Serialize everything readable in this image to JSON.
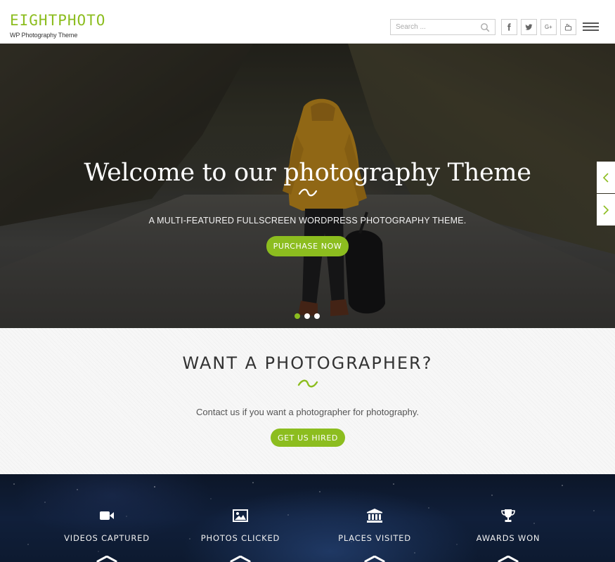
{
  "header": {
    "logo_title": "EIGHTPHOTO",
    "logo_tagline": "WP Photography Theme",
    "search_placeholder": "Search ...",
    "social": [
      {
        "icon": "facebook-icon",
        "glyph": "f"
      },
      {
        "icon": "twitter-icon",
        "glyph": "t"
      },
      {
        "icon": "google-plus-icon",
        "glyph": "G+"
      },
      {
        "icon": "youtube-icon",
        "glyph": "yt"
      }
    ]
  },
  "hero": {
    "title": "Welcome to our photography Theme",
    "subtitle": "A MULTI-FEATURED FULLSCREEN WORDPRESS PHOTOGRAPHY THEME.",
    "button_label": "PURCHASE NOW",
    "slides": 3,
    "active_slide": 1
  },
  "cta": {
    "title": "WANT A PHOTOGRAPHER?",
    "text": "Contact us if you want a photographer for photography.",
    "button_label": "GET US HIRED"
  },
  "stats": [
    {
      "icon": "video-camera-icon",
      "label": "VIDEOS CAPTURED"
    },
    {
      "icon": "image-icon",
      "label": "PHOTOS CLICKED"
    },
    {
      "icon": "bank-icon",
      "label": "PLACES VISITED"
    },
    {
      "icon": "trophy-icon",
      "label": "AWARDS WON"
    }
  ],
  "colors": {
    "accent": "#8cbd1f",
    "text_dark": "#333333",
    "stats_bg": "#0f1d36"
  }
}
